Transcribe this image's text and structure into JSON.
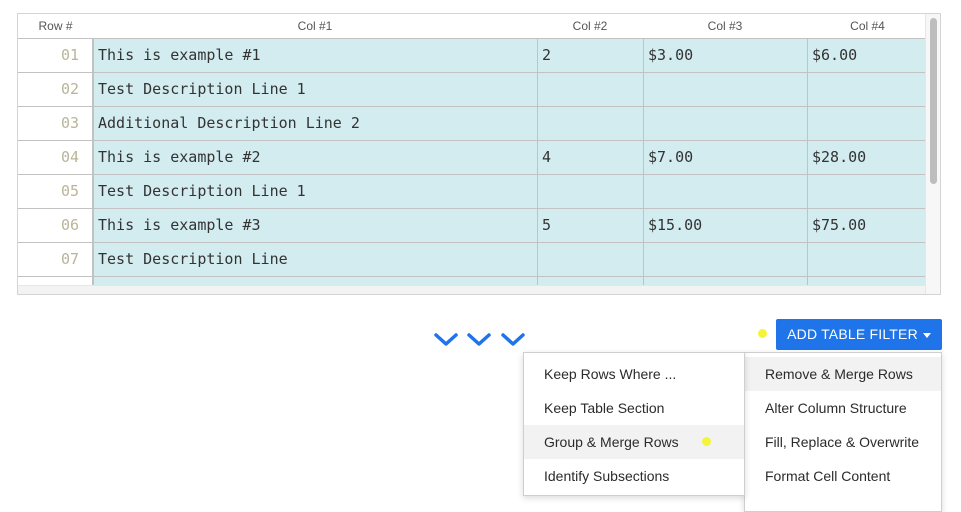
{
  "table": {
    "columns": [
      "Row #",
      "Col #1",
      "Col #2",
      "Col #3",
      "Col #4"
    ],
    "rows": [
      {
        "num": "01",
        "c1": "This is example #1",
        "c2": "2",
        "c3": "$3.00",
        "c4": "$6.00"
      },
      {
        "num": "02",
        "c1": "Test Description Line 1",
        "c2": "",
        "c3": "",
        "c4": ""
      },
      {
        "num": "03",
        "c1": "Additional Description Line 2",
        "c2": "",
        "c3": "",
        "c4": ""
      },
      {
        "num": "04",
        "c1": "This is example #2",
        "c2": "4",
        "c3": "$7.00",
        "c4": "$28.00"
      },
      {
        "num": "05",
        "c1": "Test Description Line 1",
        "c2": "",
        "c3": "",
        "c4": ""
      },
      {
        "num": "06",
        "c1": "This is example #3",
        "c2": "5",
        "c3": "$15.00",
        "c4": "$75.00"
      },
      {
        "num": "07",
        "c1": "Test Description Line",
        "c2": "",
        "c3": "",
        "c4": ""
      }
    ]
  },
  "filter_button": {
    "label": "ADD TABLE FILTER"
  },
  "menu_left": {
    "items": [
      "Keep Rows Where ...",
      "Keep Table Section",
      "Group & Merge Rows",
      "Identify Subsections"
    ]
  },
  "menu_right": {
    "items": [
      "Remove & Merge Rows",
      "Alter Column Structure",
      "Fill, Replace & Overwrite",
      "Format Cell Content"
    ]
  },
  "colors": {
    "accent": "#1e74e8",
    "cell_bg": "#d3ecef",
    "highlight_dot": "#f4f43a"
  }
}
